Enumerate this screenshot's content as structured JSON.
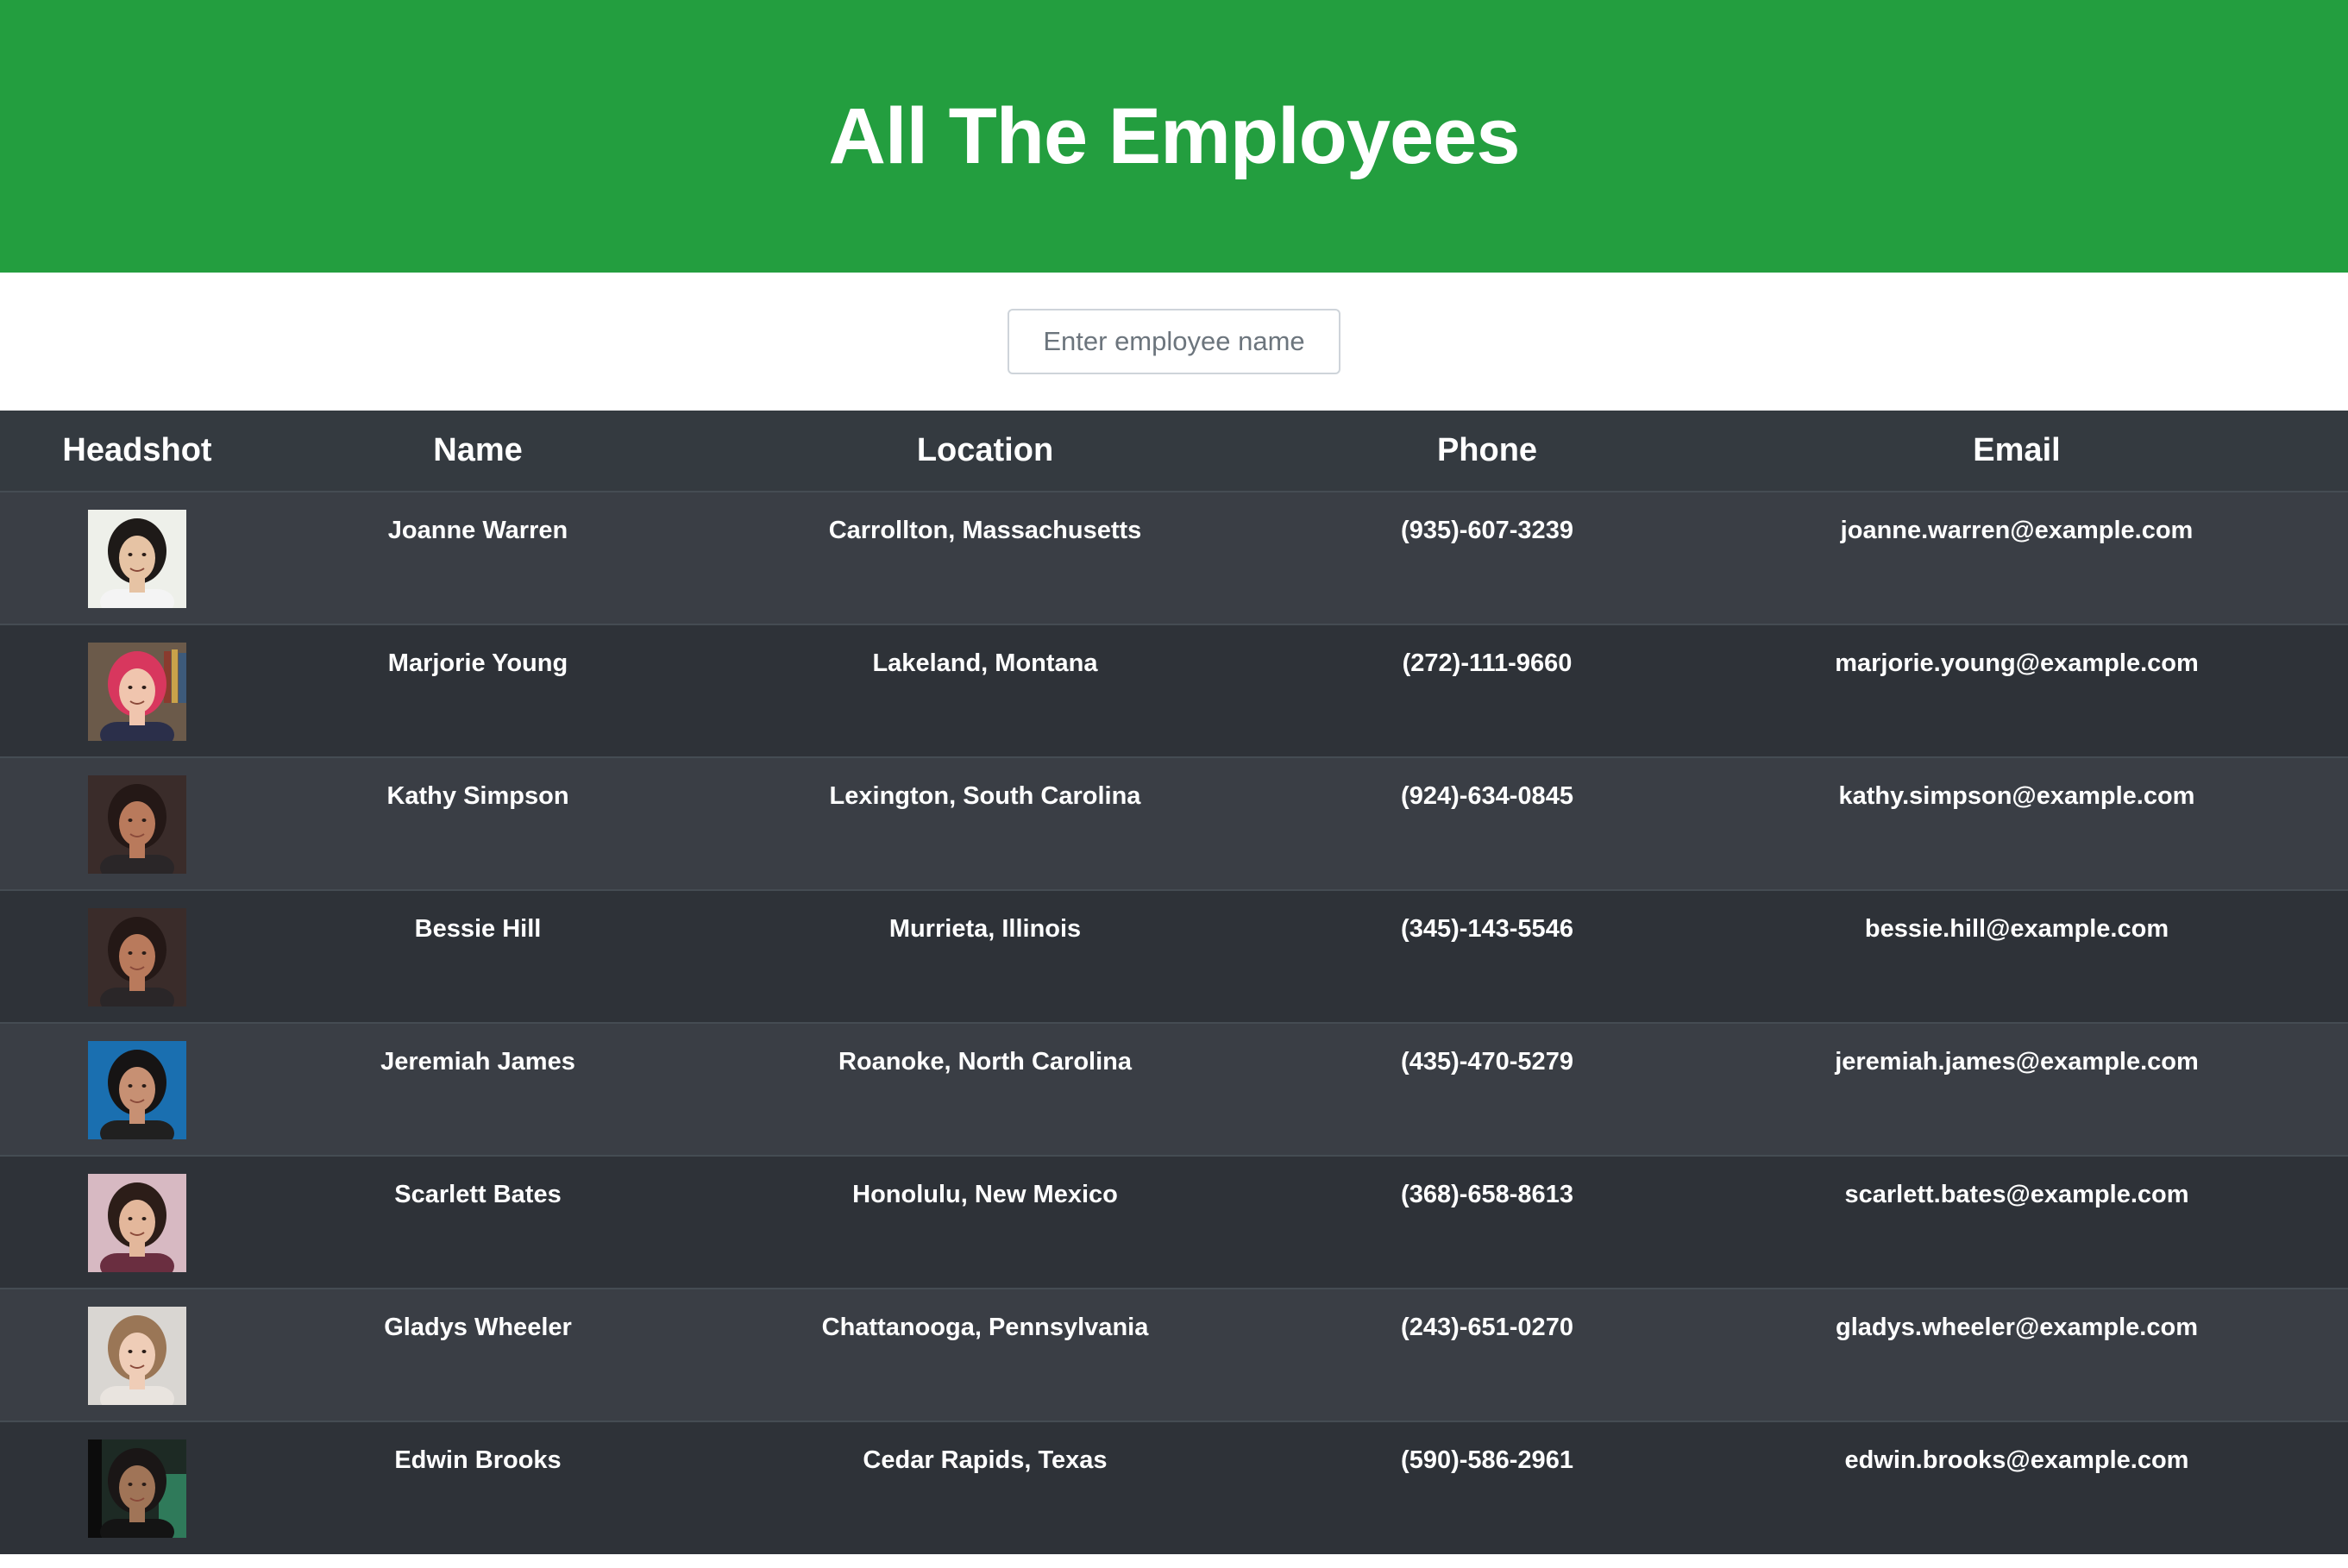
{
  "header": {
    "title": "All The Employees",
    "background": "#239e3f"
  },
  "search": {
    "placeholder": "Enter employee name",
    "value": ""
  },
  "table": {
    "columns": [
      "Headshot",
      "Name",
      "Location",
      "Phone",
      "Email"
    ],
    "rows": [
      {
        "name": "Joanne Warren",
        "location": "Carrollton, Massachusetts",
        "phone": "(935)-607-3239",
        "email": "joanne.warren@example.com",
        "headshot": "woman-portrait-light-background"
      },
      {
        "name": "Marjorie Young",
        "location": "Lakeland, Montana",
        "phone": "(272)-111-9660",
        "email": "marjorie.young@example.com",
        "headshot": "woman-pink-hair-portrait"
      },
      {
        "name": "Kathy Simpson",
        "location": "Lexington, South Carolina",
        "phone": "(924)-634-0845",
        "email": "kathy.simpson@example.com",
        "headshot": "woman-curly-hair-portrait"
      },
      {
        "name": "Bessie Hill",
        "location": "Murrieta, Illinois",
        "phone": "(345)-143-5546",
        "email": "bessie.hill@example.com",
        "headshot": "woman-curly-hair-portrait"
      },
      {
        "name": "Jeremiah James",
        "location": "Roanoke, North Carolina",
        "phone": "(435)-470-5279",
        "email": "jeremiah.james@example.com",
        "headshot": "man-blue-background-portrait"
      },
      {
        "name": "Scarlett Bates",
        "location": "Honolulu, New Mexico",
        "phone": "(368)-658-8613",
        "email": "scarlett.bates@example.com",
        "headshot": "woman-blossom-background-portrait"
      },
      {
        "name": "Gladys Wheeler",
        "location": "Chattanooga, Pennsylvania",
        "phone": "(243)-651-0270",
        "email": "gladys.wheeler@example.com",
        "headshot": "woman-wavy-hair-portrait"
      },
      {
        "name": "Edwin Brooks",
        "location": "Cedar Rapids, Texas",
        "phone": "(590)-586-2961",
        "email": "edwin.brooks@example.com",
        "headshot": "person-dark-background-portrait"
      }
    ]
  }
}
